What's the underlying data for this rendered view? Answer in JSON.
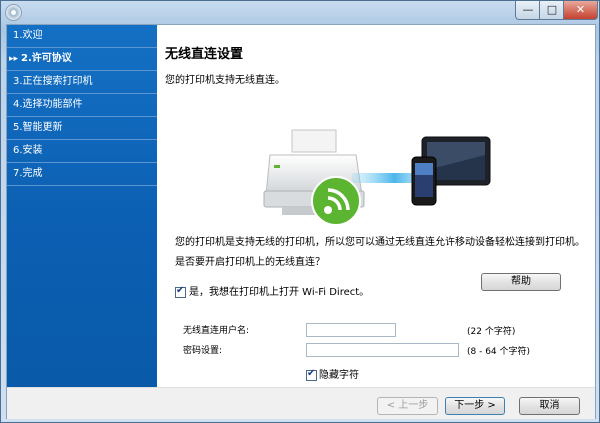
{
  "window": {
    "minimize_glyph": "—",
    "maximize_glyph": "□",
    "close_glyph": "✕"
  },
  "sidebar": {
    "current_marker": "▸▸",
    "steps": [
      {
        "label": "1.欢迎"
      },
      {
        "label": "2.许可协议"
      },
      {
        "label": "3.正在搜索打印机"
      },
      {
        "label": "4.选择功能部件"
      },
      {
        "label": "5.智能更新"
      },
      {
        "label": "6.安装"
      },
      {
        "label": "7.完成"
      }
    ],
    "current_index": 1
  },
  "main": {
    "title": "无线直连设置",
    "subtitle": "您的打印机支持无线直连。",
    "description": "您的打印机是支持无线的打印机，所以您可以通过无线直连允许移动设备轻松连接到打印机。",
    "question": "是否要开启打印机上的无线直连？",
    "help_label": "帮助",
    "enable_wifi_direct": {
      "label": "是，我想在打印机上打开 Wi-Fi Direct。",
      "checked": true
    },
    "ssid": {
      "label": "无线直连用户名:",
      "value": "",
      "hint": "(22 个字符)"
    },
    "password": {
      "label": "密码设置:",
      "value": "",
      "hint": "(8 - 64 个字符)"
    },
    "hide_chars": {
      "label": "隐藏字符",
      "checked": true
    }
  },
  "footer": {
    "back_label": "< 上一步",
    "next_label": "下一步 >",
    "cancel_label": "取消"
  },
  "colors": {
    "sidebar": "#0b5eb1",
    "wifi_green": "#5bb531",
    "window_border": "#4a6f92"
  }
}
